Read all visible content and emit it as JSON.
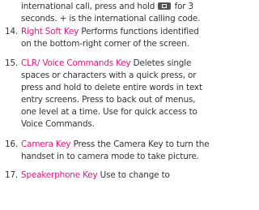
{
  "continued_text": {
    "before_icon": "international call, press and hold",
    "icon": "international-key-icon",
    "after_icon": "for 3\nseconds. + is the international calling code."
  },
  "entries": [
    {
      "number": "14.",
      "key_name": "Right Soft Key",
      "description": " Performs functions identified\non the bottom-right corner of the screen."
    },
    {
      "number": "15.",
      "key_name": "CLR/ Voice Commands Key",
      "description": " Deletes single\nspaces or characters with a quick press, or\npress and hold to delete entire words in text\nentry screens. Press to back out of menus,\none level at a time. Use for quick access to\nVoice Commands."
    },
    {
      "number": "16.",
      "key_name": "Camera Key",
      "description": " Press the Camera Key to turn the\nhandset in to camera mode to take picture."
    },
    {
      "number": "17.",
      "key_name": "Speakerphone Key",
      "description": " Use to change to"
    }
  ],
  "colors": {
    "key_name": "#e0137d",
    "body_text": "#333333"
  }
}
